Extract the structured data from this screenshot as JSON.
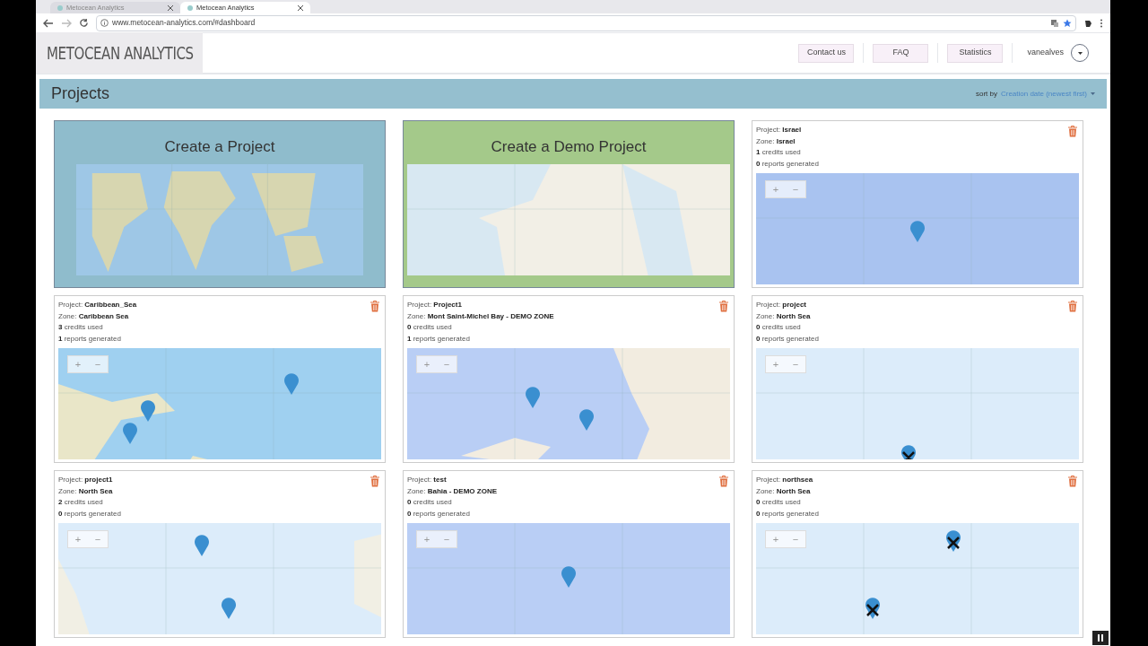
{
  "browser": {
    "tabs": [
      {
        "title": "Metocean Analytics",
        "selected": false
      },
      {
        "title": "Metocean Analytics",
        "selected": true
      }
    ],
    "url": "www.metocean-analytics.com/#dashboard"
  },
  "header": {
    "logo_text": "METOCEAN ANALYTICS",
    "nav": [
      "Contact us",
      "FAQ",
      "Statistics"
    ],
    "user": "vanealves"
  },
  "projects_bar": {
    "title": "Projects",
    "sort_label": "sort by",
    "sort_value": "Creation date (newest first)"
  },
  "cards": [
    {
      "kind": "create",
      "title": "Create a Project"
    },
    {
      "kind": "demo",
      "title": "Create a Demo Project"
    },
    {
      "kind": "project",
      "project": "Project: **Israel**",
      "zone": "Zone: **Israel**",
      "credits": "**1** credits used",
      "reports": "**0** reports generated",
      "zoom": [
        "+",
        "−"
      ]
    },
    {
      "kind": "project",
      "project": "Project: **Caribbean_Sea**",
      "zone": "Zone: **Caribbean Sea**",
      "credits": "**3** credits used",
      "reports": "**1** reports generated",
      "zoom": [
        "+",
        "−"
      ]
    },
    {
      "kind": "project",
      "project": "Project: **Project1**",
      "zone": "Zone: **Mont Saint-Michel Bay - DEMO ZONE**",
      "credits": "**0** credits used",
      "reports": "**1** reports generated",
      "zoom": [
        "+",
        "−"
      ]
    },
    {
      "kind": "project",
      "project": "Project: **project**",
      "zone": "Zone: **North Sea**",
      "credits": "**0** credits used",
      "reports": "**0** reports generated",
      "zoom": [
        "+",
        "−"
      ]
    },
    {
      "kind": "project",
      "project": "Project: **project1**",
      "zone": "Zone: **North Sea**",
      "credits": "**2** credits used",
      "reports": "**0** reports generated",
      "zoom": [
        "+",
        "−"
      ]
    },
    {
      "kind": "project",
      "project": "Project: **test**",
      "zone": "Zone: **Bahia - DEMO ZONE**",
      "credits": "**0** credits used",
      "reports": "**0** reports generated",
      "zoom": [
        "+",
        "−"
      ]
    },
    {
      "kind": "project",
      "project": "Project: **northsea**",
      "zone": "Zone: **North Sea**",
      "credits": "**0** credits used",
      "reports": "**0** reports generated",
      "zoom": [
        "+",
        "−"
      ]
    }
  ]
}
